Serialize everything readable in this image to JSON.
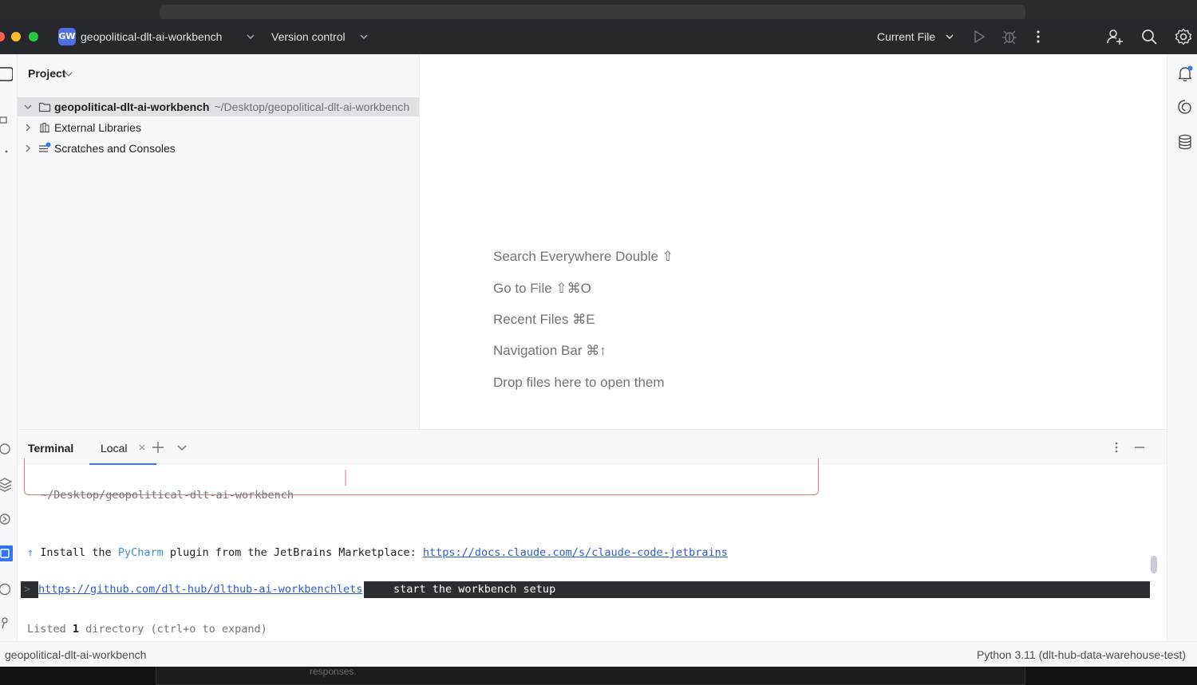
{
  "titlebar": {
    "project_badge": "GW",
    "project_name": "geopolitical-dlt-ai-workbench",
    "version_control": "Version control",
    "run_config": "Current File",
    "icons": [
      "run-icon",
      "debug-icon",
      "more-vert-icon",
      "add-user-icon",
      "search-icon",
      "settings-icon"
    ]
  },
  "project_panel": {
    "title": "Project",
    "items": [
      {
        "name": "geopolitical-dlt-ai-workbench",
        "path": "~/Desktop/geopolitical-dlt-ai-workbench",
        "icon": "folder-icon",
        "expanded": true
      },
      {
        "name": "External Libraries",
        "icon": "libraries-icon",
        "expanded": false
      },
      {
        "name": "Scratches and Consoles",
        "icon": "scratches-icon",
        "expanded": false
      }
    ]
  },
  "editor_hints": [
    "Search Everywhere Double ⇧",
    "Go to File ⇧⌘O",
    "Recent Files ⌘E",
    "Navigation Bar ⌘↑",
    "Drop files here to open them"
  ],
  "terminal": {
    "title": "Terminal",
    "tab_label": "Local",
    "box_path": "~/Desktop/geopolitical-dlt-ai-workbench",
    "install_arrow": "↑",
    "install_prefix": "Install the",
    "install_product": "PyCharm",
    "install_middle": "plugin from the JetBrains Marketplace:",
    "install_link": "https://docs.claude.com/s/claude-code-jetbrains",
    "prompt_marker": ">",
    "prompt_link": "https://github.com/dlt-hub/dlthub-ai-workbenchlets",
    "prompt_text": "start the workbench setup",
    "listed_prefix": "Listed",
    "listed_count": "1",
    "listed_suffix": "directory (ctrl+o to expand)"
  },
  "statusbar": {
    "left": "geopolitical-dlt-ai-workbench",
    "right": "Python 3.11 (dlt-hub-data-warehouse-test)"
  },
  "background": {
    "bottom_text": "responses."
  },
  "colors": {
    "titlebar_bg": "#27282c",
    "accent_blue": "#3574f0",
    "badge": "#4e6ee6",
    "box_border": "#e07a7a"
  }
}
